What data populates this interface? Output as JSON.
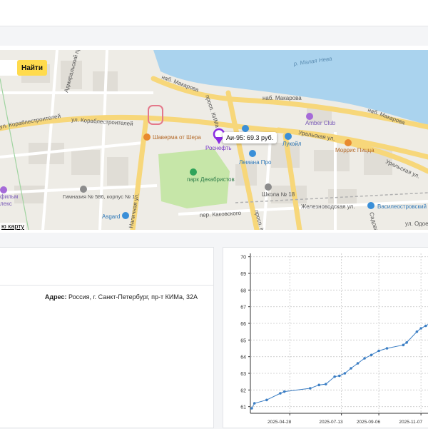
{
  "map": {
    "search_button": "Найти",
    "open_map_link": "ю карту",
    "price_label": "Аи-95: 69.3 руб.",
    "labels": {
      "river": "р. Малая Нева",
      "nab_makarova_1": "наб. Макарова",
      "nab_makarova_2": "наб. Макарова",
      "nab_makarova_3": "наб. Макарова",
      "pr_kima": "просп. КИМа",
      "pr_kima_2": "просп. КИМа",
      "korabl_1": "ул. Кораблестроителей",
      "korabl_2": "ул. Кораблестроителей",
      "uralskaya_1": "Уральская ул.",
      "uralskaya_2": "Уральская ул.",
      "admiralsky": "Адмиральский пр.",
      "nalichnaya": "Наличная ул.",
      "kakovsky": "пер. Каковского",
      "zheleznovodskaya": "Железноводская ул.",
      "odoevsky": "ул. Одоевс",
      "sarabandova": "Садовая ул.",
      "amber": "Amber Club",
      "shaverma": "Шаверма от Шера",
      "rosneft": "Роснефть",
      "lukoil": "Лукойл",
      "morris": "Моррис Пицца",
      "lemana": "Лемана Про",
      "park": "парк Декабристов",
      "school": "Школа № 18",
      "gymnasium": "Гимназия № 586, корпус № 1",
      "asgard": "Asgard",
      "vasileostrovsky": "Василеостровский",
      "film_a": "фильм",
      "film_b": "лекс"
    },
    "colors": {
      "water": "#aad3ee",
      "road_major": "#f7d77a",
      "park": "#c6e6a8",
      "marker": "#8a2be2"
    }
  },
  "info": {
    "address_label": "Адрес:",
    "address_value": "Россия, г. Санкт-Петербург, пр-т КИМа, 32А"
  },
  "chart_data": {
    "type": "line",
    "title": "",
    "xlabel": "",
    "ylabel": "",
    "ylim": [
      60.6,
      70.2
    ],
    "yticks": [
      61,
      62,
      63,
      64,
      65,
      66,
      67,
      68,
      69,
      70
    ],
    "xticks": [
      "2025-04-28",
      "2025-07-13",
      "2025-09-06",
      "2025-11-07"
    ],
    "grid": true,
    "series": [
      {
        "color": "#3b7ec4",
        "x": [
          "2025-03-03",
          "2025-03-07",
          "2025-03-25",
          "2025-04-14",
          "2025-04-20",
          "2025-05-28",
          "2025-06-10",
          "2025-06-20",
          "2025-07-03",
          "2025-07-10",
          "2025-07-18",
          "2025-07-27",
          "2025-08-06",
          "2025-08-16",
          "2025-08-26",
          "2025-09-06",
          "2025-09-18",
          "2025-10-12",
          "2025-10-17",
          "2025-11-01",
          "2025-11-07",
          "2025-11-14",
          "2025-11-22",
          "2025-12-05"
        ],
        "y": [
          60.9,
          61.2,
          61.4,
          61.8,
          61.9,
          62.1,
          62.3,
          62.35,
          62.8,
          62.85,
          63.0,
          63.3,
          63.6,
          63.9,
          64.1,
          64.35,
          64.5,
          64.7,
          64.85,
          65.5,
          65.7,
          65.85,
          66.05,
          66.2
        ]
      }
    ]
  }
}
